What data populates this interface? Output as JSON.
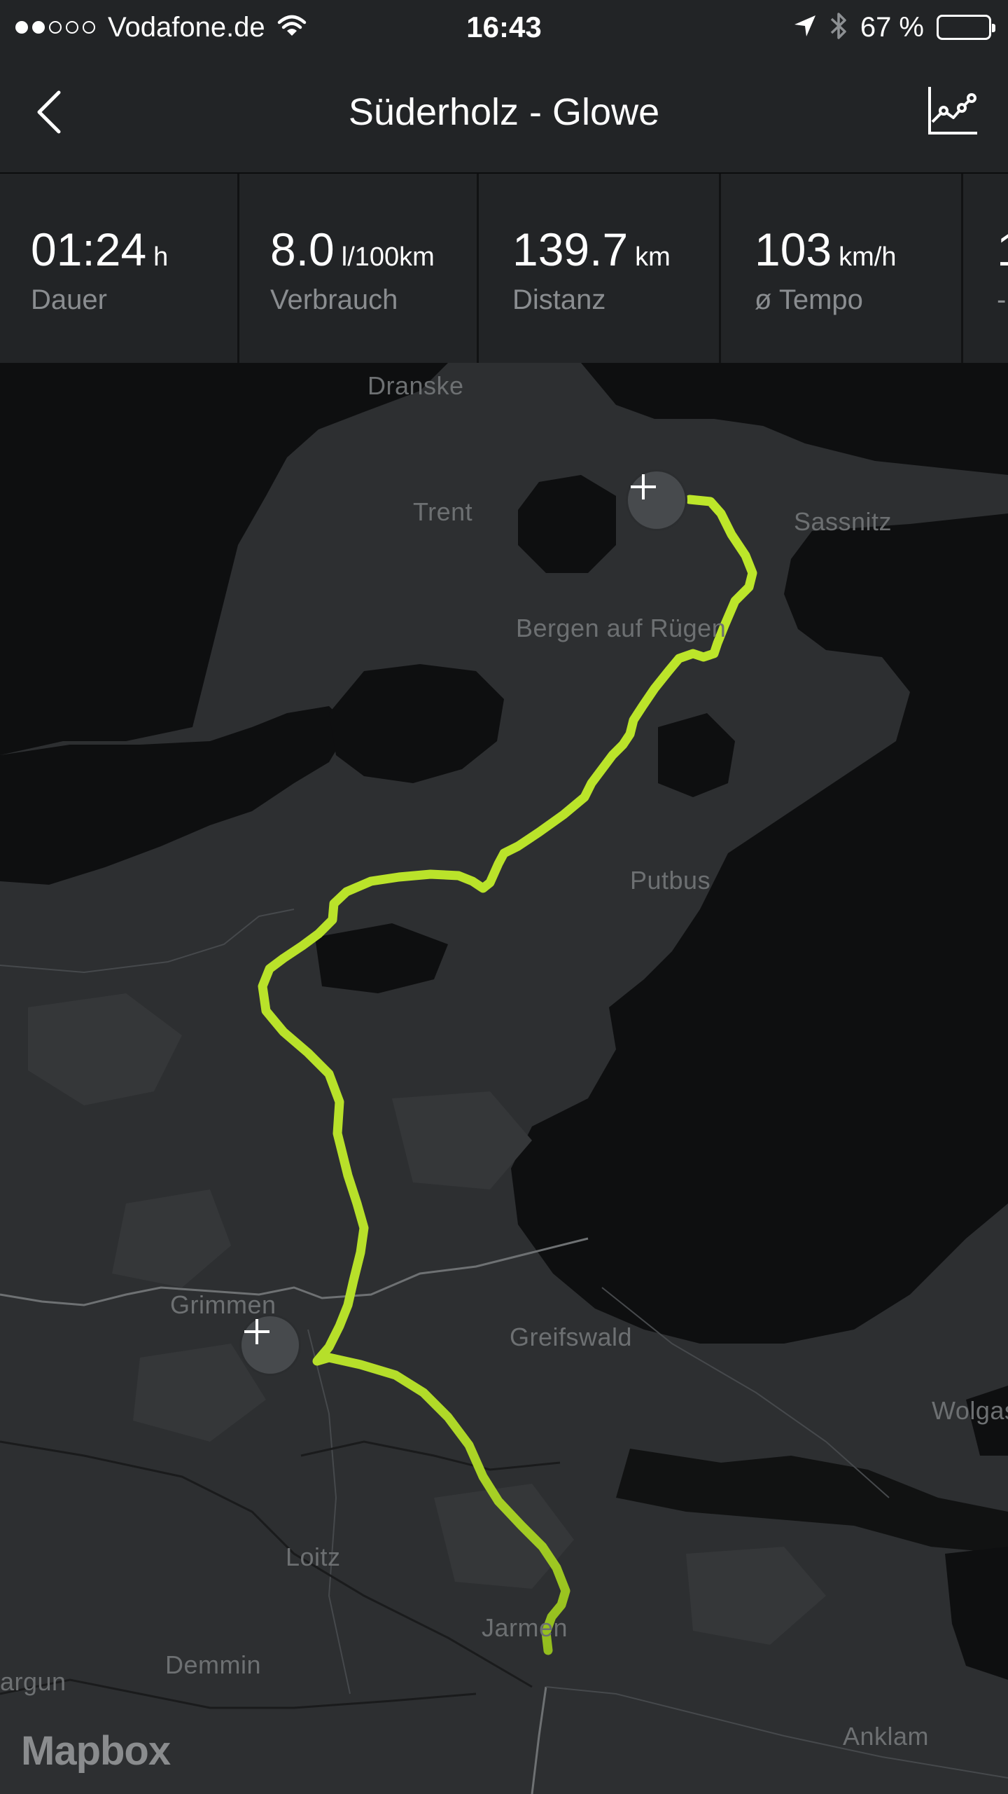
{
  "status_bar": {
    "carrier": "Vodafone.de",
    "time": "16:43",
    "battery_percent": "67 %",
    "battery_level": 0.67,
    "signal_bars_filled": 2,
    "signal_bars_total": 5
  },
  "nav": {
    "title": "Süderholz - Glowe",
    "back_icon": "chevron-left-icon",
    "stats_icon": "line-chart-icon"
  },
  "stats": [
    {
      "value": "01:24",
      "unit": "h",
      "label": "Dauer"
    },
    {
      "value": "8.0",
      "unit": "l/100km",
      "label": "Verbrauch"
    },
    {
      "value": "139.7",
      "unit": "km",
      "label": "Distanz"
    },
    {
      "value": "103",
      "unit": "km/h",
      "label": "ø Tempo"
    },
    {
      "value": "1",
      "unit": "",
      "label": "-"
    }
  ],
  "map": {
    "places": [
      "Dranske",
      "Trent",
      "Sassnitz",
      "Bergen auf Rügen",
      "Putbus",
      "Grimmen",
      "Greifswald",
      "Wolgast",
      "Loitz",
      "Demmin",
      "Jarmen",
      "Anklam",
      "argun"
    ],
    "attribution": "Mapbox",
    "route_color": "#b8e22a",
    "waypoint_icon": "plus-icon"
  }
}
